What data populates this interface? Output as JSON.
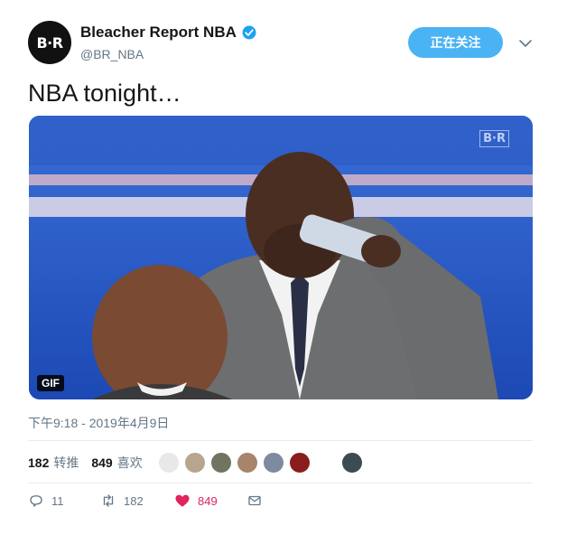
{
  "account": {
    "avatar_text": "B·R",
    "display_name": "Bleacher Report NBA",
    "handle": "@BR_NBA",
    "verified": true
  },
  "follow_button": {
    "label": "正在关注"
  },
  "tweet": {
    "text": "NBA tonight…",
    "timestamp": "下午9:18 - 2019年4月9日"
  },
  "media": {
    "badge": "GIF",
    "watermark": "B·R"
  },
  "stats": {
    "retweets_count": "182",
    "retweets_label": "转推",
    "likes_count": "849",
    "likes_label": "喜欢"
  },
  "actions": {
    "reply_count": "11",
    "retweet_count": "182",
    "like_count": "849"
  },
  "colors": {
    "accent": "#4ab3f4",
    "like": "#e0245e",
    "muted": "#657786",
    "verified": "#1da1f2"
  }
}
